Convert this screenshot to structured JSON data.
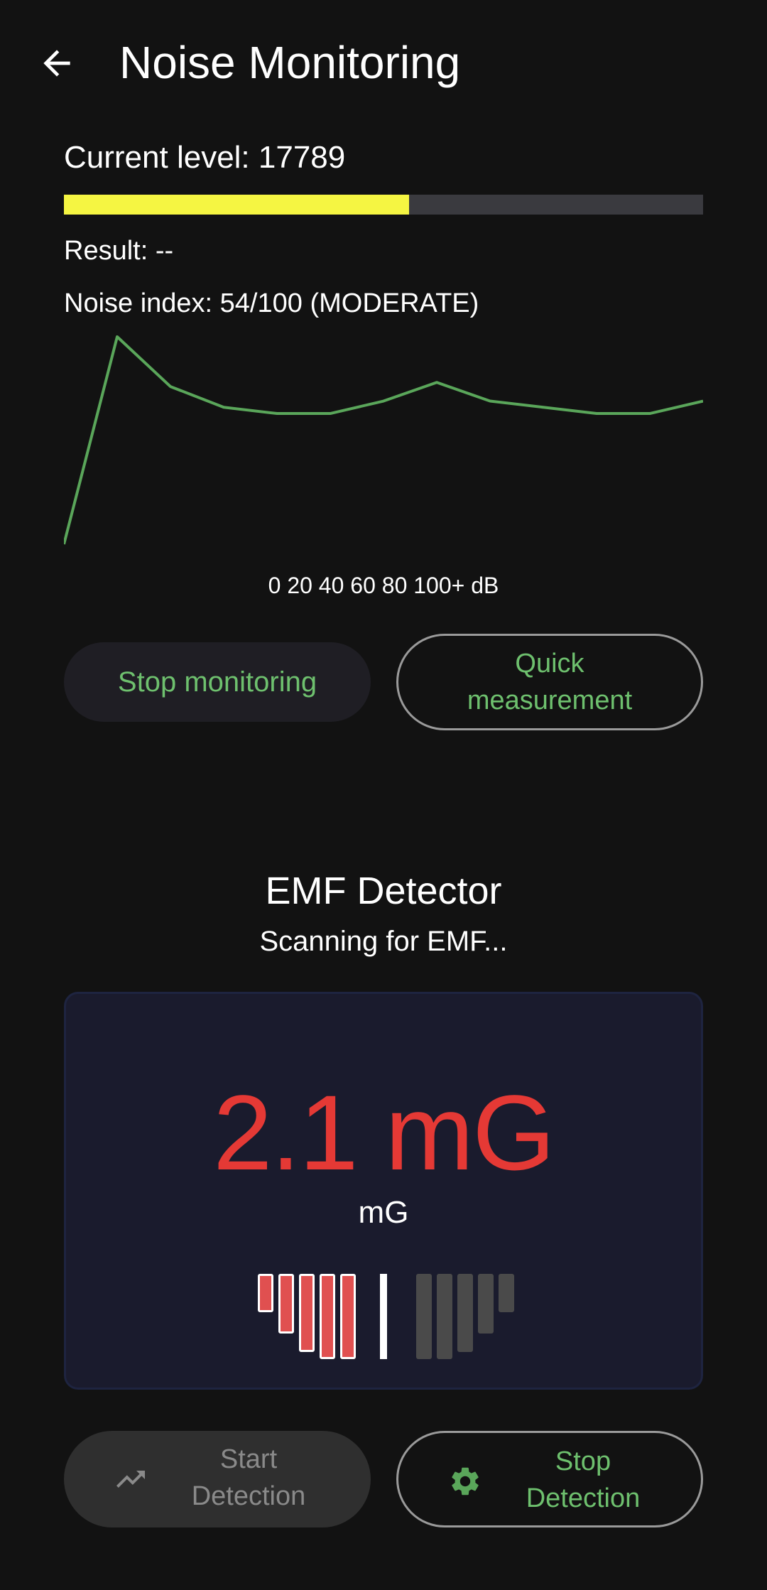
{
  "app_bar": {
    "title": "Noise Monitoring",
    "back_icon": "arrow-back-icon"
  },
  "noise": {
    "current_level": "Current level: 17789",
    "level_fraction": 0.54,
    "level_color": "#f5f542",
    "result": "Result: --",
    "noise_index": "Noise index: 54/100 (MODERATE)",
    "scale_label": "0 20 40 60 80 100+ dB"
  },
  "chart_data": {
    "type": "line",
    "series": [
      {
        "values": [
          0,
          100,
          76,
          66,
          63,
          63,
          69,
          78,
          69,
          66,
          63,
          63,
          69
        ]
      }
    ],
    "ylim": [
      0,
      100
    ],
    "color": "#5aa65a",
    "grid": false
  },
  "buttons": {
    "stop_monitoring": "Stop monitoring",
    "quick_measurement": "Quick measurement",
    "start_detection": "Start Detection",
    "stop_detection": "Stop Detection",
    "start_icon": "trending-up-icon",
    "stop_icon": "gear-icon"
  },
  "emf": {
    "title": "EMF Detector",
    "status": "Scanning for EMF...",
    "value": "2.1 mG",
    "unit": "mG",
    "value_color": "#e53935",
    "meter": {
      "active_bars": 5,
      "total_bars": 10,
      "active_color": "#e05050",
      "inactive_color": "#4a4a4a"
    }
  }
}
